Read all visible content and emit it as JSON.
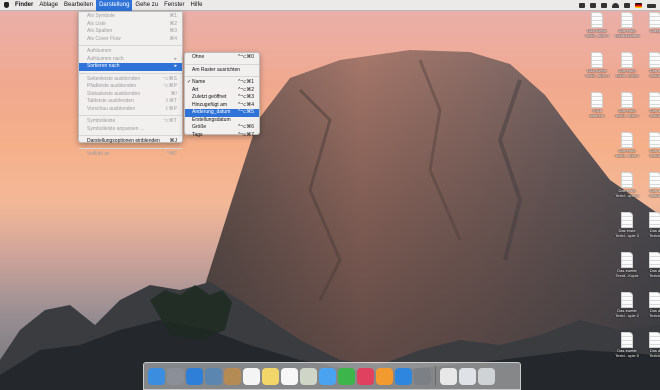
{
  "menubar": {
    "app_name": "Finder",
    "items": [
      "Ablage",
      "Bearbeiten",
      "Darstellung",
      "Gehe zu",
      "Fenster",
      "Hilfe"
    ],
    "active_item": "Darstellung"
  },
  "darstellung_menu": {
    "items": [
      {
        "label": "Als Symbole",
        "shortcut": "⌘1",
        "enabled": false
      },
      {
        "label": "Als Liste",
        "shortcut": "⌘2",
        "enabled": false
      },
      {
        "label": "Als Spalten",
        "shortcut": "⌘3",
        "enabled": false
      },
      {
        "label": "Als Cover Flow",
        "shortcut": "⌘4",
        "enabled": false
      },
      {
        "label": "Aufräumen",
        "shortcut": "",
        "enabled": false
      },
      {
        "label": "Aufräumen nach",
        "shortcut": "▸",
        "enabled": false
      },
      {
        "label": "Sortieren nach",
        "shortcut": "▸",
        "enabled": true,
        "selected": true
      },
      {
        "label": "Seitenleiste ausblenden",
        "shortcut": "⌥⌘S",
        "enabled": false
      },
      {
        "label": "Pfadleiste ausblenden",
        "shortcut": "⌥⌘P",
        "enabled": false
      },
      {
        "label": "Statusleiste ausblenden",
        "shortcut": "⌘/",
        "enabled": false
      },
      {
        "label": "Tableiste ausblenden",
        "shortcut": "⇧⌘T",
        "enabled": false
      },
      {
        "label": "Vorschau ausblenden",
        "shortcut": "⇧⌘P",
        "enabled": false
      },
      {
        "label": "Symbolleiste",
        "shortcut": "⌥⌘T",
        "enabled": false
      },
      {
        "label": "Symbolleiste anpassen ...",
        "shortcut": "",
        "enabled": false
      },
      {
        "label": "Darstellungsoptionen einblenden",
        "shortcut": "⌘J",
        "enabled": true
      },
      {
        "label": "Vollbild an",
        "shortcut": "^⌘F",
        "enabled": false
      }
    ]
  },
  "sort_menu": {
    "items": [
      {
        "label": "Ohne",
        "shortcut": "^⌥⌘0",
        "checked": false
      },
      {
        "label": "Am Raster ausrichten",
        "shortcut": "",
        "checked": false
      },
      {
        "label": "Name",
        "shortcut": "^⌥⌘1",
        "checked": true
      },
      {
        "label": "Art",
        "shortcut": "^⌥⌘2",
        "checked": false
      },
      {
        "label": "Zuletzt geöffnet",
        "shortcut": "^⌥⌘3",
        "checked": false
      },
      {
        "label": "Hinzugefügt am",
        "shortcut": "^⌥⌘4",
        "checked": false
      },
      {
        "label": "Änderung_datum",
        "shortcut": "^⌥⌘5",
        "checked": false,
        "selected": true
      },
      {
        "label": "Erstellungsdatum",
        "shortcut": "",
        "checked": false
      },
      {
        "label": "Größe",
        "shortcut": "^⌥⌘6",
        "checked": false
      },
      {
        "label": "Tags",
        "shortcut": "^⌥⌘7",
        "checked": false
      }
    ]
  },
  "desktop_icons": [
    {
      "label1": "Das zweite",
      "label2": "Textd...opie 4"
    },
    {
      "label1": "Das erste",
      "label2": "Textdokument"
    },
    {
      "label1": "Crazy",
      "label2": ""
    },
    {
      "label1": "Das zweite",
      "label2": "Textd...opie 3"
    },
    {
      "label1": "Das erste",
      "label2": "Textd...Kopie"
    },
    {
      "label1": "Das e",
      "label2": "Textdo"
    },
    {
      "label1": "Think",
      "label2": "different"
    },
    {
      "label1": "Das erste",
      "label2": "Textd...opie 2"
    },
    {
      "label1": "Das d",
      "label2": "Textdo"
    },
    {
      "label1": "Das erste",
      "label2": "Textd...opie 4"
    },
    {
      "label1": "Das d",
      "label2": "Textdo"
    },
    {
      "label1": "Das erste",
      "label2": "Textd...opie 5"
    },
    {
      "label1": "Das d",
      "label2": "Textdo"
    },
    {
      "label1": "Das erste",
      "label2": "Textd...opie 3"
    },
    {
      "label1": "Das d",
      "label2": "Textdo"
    },
    {
      "label1": "Das zweite",
      "label2": "Textd...Kopie"
    },
    {
      "label1": "Das d",
      "label2": "Textdo"
    },
    {
      "label1": "Das zweite",
      "label2": "Textd...opie 2"
    },
    {
      "label1": "Das d",
      "label2": "Textdo"
    },
    {
      "label1": "Das zweite",
      "label2": "Textd...opie 5"
    },
    {
      "label1": "Das d",
      "label2": "Textdo"
    }
  ],
  "dock_apps": [
    {
      "name": "finder-icon",
      "color": "#3b8de0"
    },
    {
      "name": "launchpad-icon",
      "color": "#8a8f98"
    },
    {
      "name": "safari-icon",
      "color": "#2d7fd8"
    },
    {
      "name": "preview-icon",
      "color": "#5a86b0"
    },
    {
      "name": "contacts-icon",
      "color": "#b48a55"
    },
    {
      "name": "calendar-icon",
      "color": "#f4f4f4"
    },
    {
      "name": "notes-icon",
      "color": "#f2d66a"
    },
    {
      "name": "reminders-icon",
      "color": "#f7f7f7"
    },
    {
      "name": "photos-icon",
      "color": "#cfd6c8"
    },
    {
      "name": "messages-icon",
      "color": "#4aa3f0"
    },
    {
      "name": "facetime-icon",
      "color": "#3cb54a"
    },
    {
      "name": "itunes-icon",
      "color": "#e0415e"
    },
    {
      "name": "ibooks-icon",
      "color": "#f29a2e"
    },
    {
      "name": "appstore-icon",
      "color": "#2e86de"
    },
    {
      "name": "system-preferences-icon",
      "color": "#7b7f86"
    },
    {
      "name": "separator",
      "color": ""
    },
    {
      "name": "documents-stack-icon",
      "color": "#e8e8e8"
    },
    {
      "name": "downloads-stack-icon",
      "color": "#dfe3e8"
    },
    {
      "name": "trash-icon",
      "color": "#d0d3d6"
    }
  ]
}
